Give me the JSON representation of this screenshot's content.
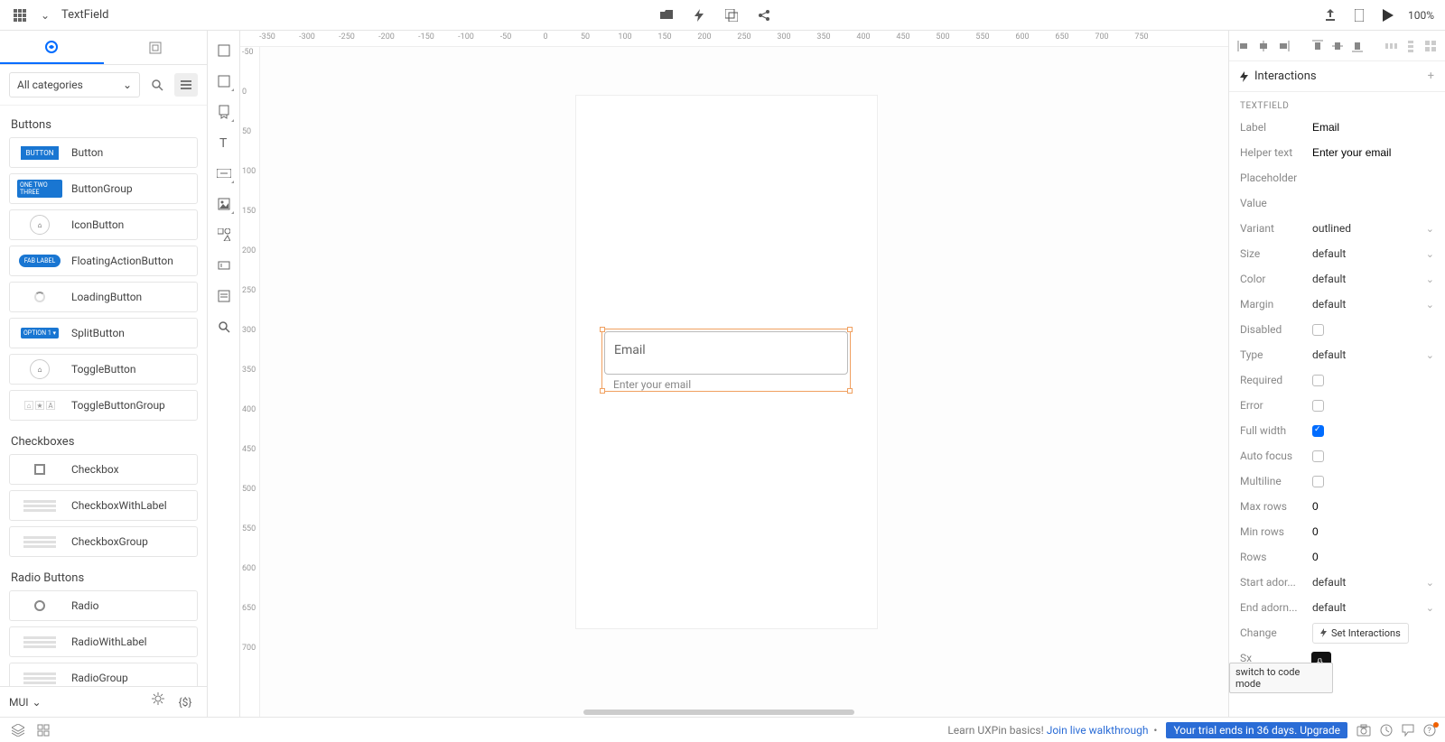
{
  "topbar": {
    "breadcrumb": "TextField",
    "zoom": "100%"
  },
  "left_panel": {
    "category_filter": "All categories",
    "library_name": "MUI",
    "sections": [
      {
        "title": "Buttons",
        "items": [
          {
            "name": "Button",
            "thumb": "BUTTON",
            "style": "blue"
          },
          {
            "name": "ButtonGroup",
            "thumb": "ONE TWO THREE",
            "style": "blue-sm"
          },
          {
            "name": "IconButton",
            "thumb": "⌂",
            "style": "icon"
          },
          {
            "name": "FloatingActionButton",
            "thumb": "FAB LABEL",
            "style": "pill"
          },
          {
            "name": "LoadingButton",
            "thumb": "",
            "style": "loading"
          },
          {
            "name": "SplitButton",
            "thumb": "OPTION 1 ▾",
            "style": "blue-sm"
          },
          {
            "name": "ToggleButton",
            "thumb": "⌂",
            "style": "icon"
          },
          {
            "name": "ToggleButtonGroup",
            "thumb": "",
            "style": "toggle"
          }
        ]
      },
      {
        "title": "Checkboxes",
        "items": [
          {
            "name": "Checkbox",
            "thumb": "",
            "style": "checkbox"
          },
          {
            "name": "CheckboxWithLabel",
            "thumb": "",
            "style": "lines"
          },
          {
            "name": "CheckboxGroup",
            "thumb": "",
            "style": "lines"
          }
        ]
      },
      {
        "title": "Radio Buttons",
        "items": [
          {
            "name": "Radio",
            "thumb": "",
            "style": "radio"
          },
          {
            "name": "RadioWithLabel",
            "thumb": "",
            "style": "lines"
          },
          {
            "name": "RadioGroup",
            "thumb": "",
            "style": "lines"
          }
        ]
      }
    ]
  },
  "ruler_h": [
    "-350",
    "-300",
    "-250",
    "-200",
    "-150",
    "-100",
    "-50",
    "0",
    "50",
    "100",
    "150",
    "200",
    "250",
    "300",
    "350",
    "400",
    "450",
    "500",
    "550",
    "600",
    "650",
    "700",
    "750"
  ],
  "ruler_v": [
    "-50",
    "0",
    "50",
    "100",
    "150",
    "200",
    "250",
    "300",
    "350",
    "400",
    "450",
    "500",
    "550",
    "600",
    "650",
    "700"
  ],
  "canvas": {
    "textfield_label": "Email",
    "textfield_helper": "Enter your email"
  },
  "right_panel": {
    "interactions_title": "Interactions",
    "section": "TEXTFIELD",
    "set_interactions": "Set Interactions",
    "props": [
      {
        "key": "Label",
        "val": "Email",
        "type": "text"
      },
      {
        "key": "Helper text",
        "val": "Enter your email",
        "type": "text"
      },
      {
        "key": "Placeholder",
        "val": "",
        "type": "text"
      },
      {
        "key": "Value",
        "val": "",
        "type": "text"
      },
      {
        "key": "Variant",
        "val": "outlined",
        "type": "dropdown"
      },
      {
        "key": "Size",
        "val": "default",
        "type": "dropdown"
      },
      {
        "key": "Color",
        "val": "default",
        "type": "dropdown"
      },
      {
        "key": "Margin",
        "val": "default",
        "type": "dropdown"
      },
      {
        "key": "Disabled",
        "val": false,
        "type": "check"
      },
      {
        "key": "Type",
        "val": "default",
        "type": "dropdown"
      },
      {
        "key": "Required",
        "val": false,
        "type": "check"
      },
      {
        "key": "Error",
        "val": false,
        "type": "check"
      },
      {
        "key": "Full width",
        "val": true,
        "type": "check"
      },
      {
        "key": "Auto focus",
        "val": false,
        "type": "check"
      },
      {
        "key": "Multiline",
        "val": false,
        "type": "check"
      },
      {
        "key": "Max rows",
        "val": "0",
        "type": "text"
      },
      {
        "key": "Min rows",
        "val": "0",
        "type": "text"
      },
      {
        "key": "Rows",
        "val": "0",
        "type": "text"
      },
      {
        "key": "Start ador...",
        "val": "default",
        "type": "dropdown"
      },
      {
        "key": "End adorn...",
        "val": "default",
        "type": "dropdown"
      },
      {
        "key": "Change",
        "val": "",
        "type": "button"
      },
      {
        "key": "Sx",
        "val": "",
        "type": "text"
      }
    ],
    "tooltip": "switch to code mode"
  },
  "bottombar": {
    "learn_prefix": "Learn UXPin basics!",
    "learn_link": "Join live walkthrough",
    "trial": "Your trial ends in 36 days. Upgrade"
  }
}
